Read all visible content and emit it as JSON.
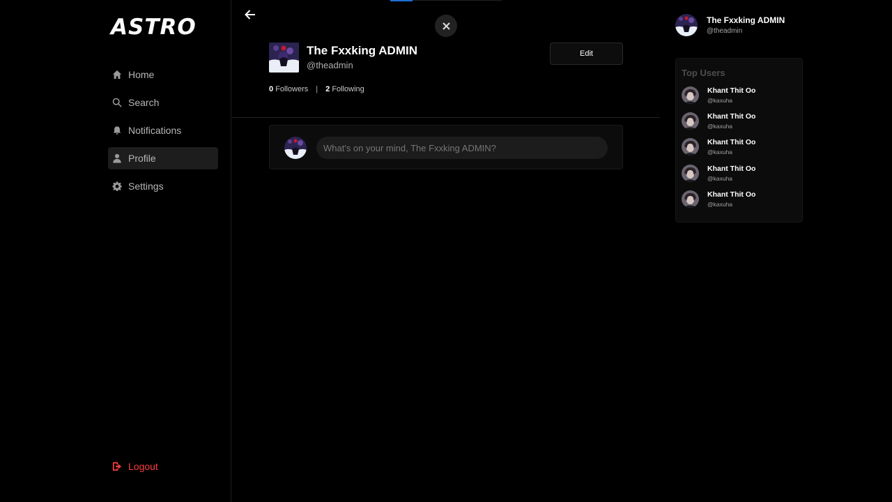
{
  "app": {
    "logo": "ASTRO"
  },
  "sidebar": {
    "items": [
      {
        "label": "Home",
        "icon": "home-icon"
      },
      {
        "label": "Search",
        "icon": "search-icon"
      },
      {
        "label": "Notifications",
        "icon": "bell-icon"
      },
      {
        "label": "Profile",
        "icon": "user-icon",
        "active": true
      },
      {
        "label": "Settings",
        "icon": "gear-icon"
      }
    ],
    "logout_label": "Logout"
  },
  "profile": {
    "name": "The Fxxking ADMIN",
    "handle": "@theadmin",
    "edit_label": "Edit",
    "followers_count": "0",
    "followers_label": "Followers",
    "separator": "|",
    "following_count": "2",
    "following_label": "Following"
  },
  "composer": {
    "placeholder": "What's on your mind, The Fxxking ADMIN?"
  },
  "current_user": {
    "name": "The Fxxking ADMIN",
    "handle": "@theadmin"
  },
  "top_users": {
    "title": "Top Users",
    "users": [
      {
        "name": "Khant Thit Oo",
        "handle": "@kaxuha"
      },
      {
        "name": "Khant Thit Oo",
        "handle": "@kaxuha"
      },
      {
        "name": "Khant Thit Oo",
        "handle": "@kaxuha"
      },
      {
        "name": "Khant Thit Oo",
        "handle": "@kaxuha"
      },
      {
        "name": "Khant Thit Oo",
        "handle": "@kaxuha"
      }
    ]
  },
  "colors": {
    "background": "#000000",
    "logout": "#ff3d3d",
    "active_nav": "#1d1d1d",
    "accent": "#1d6fd6"
  }
}
